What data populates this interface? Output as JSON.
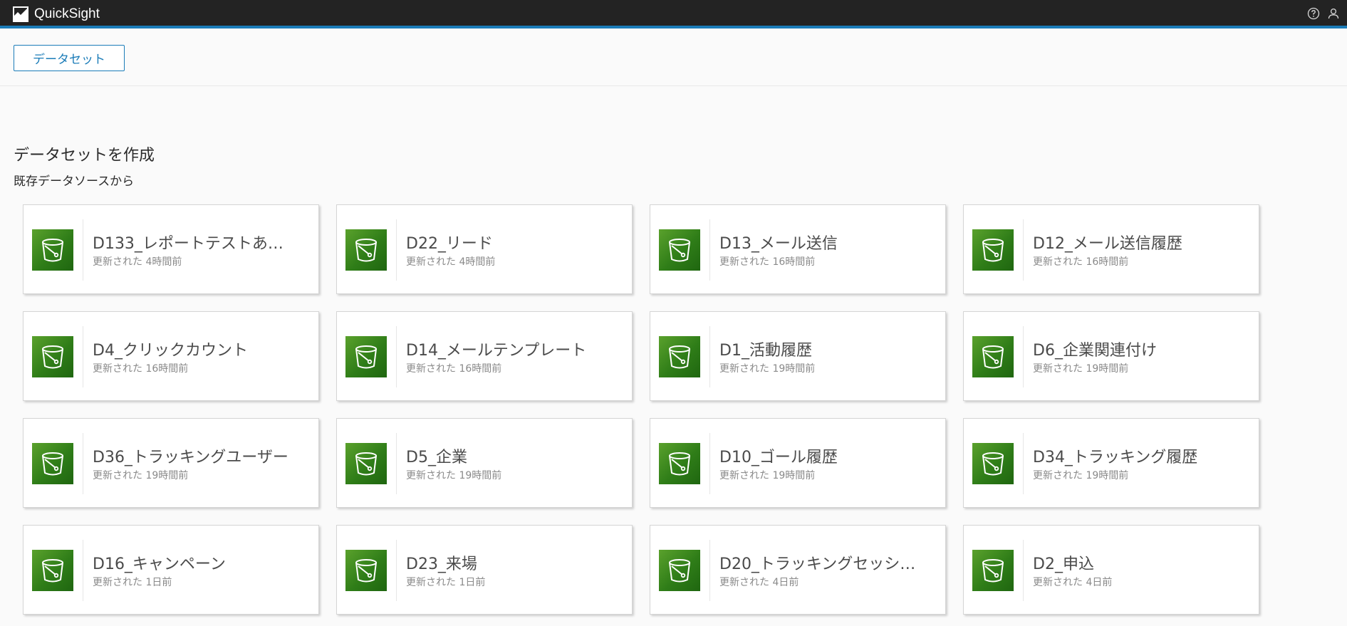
{
  "topbar": {
    "brand": "QuickSight",
    "icons": [
      "help-icon",
      "user-icon"
    ]
  },
  "toolbar": {
    "dataset_label": "データセット"
  },
  "section": {
    "title": "データセットを作成",
    "subtitle": "既存データソースから"
  },
  "colors": {
    "accent": "#1b7cb8",
    "topbar_bg": "#232323",
    "icon_green": "#3a8a1e"
  },
  "cards": [
    {
      "name": "D133_レポートテストあ…",
      "updated": "更新された 4時間前"
    },
    {
      "name": "D22_リード",
      "updated": "更新された 4時間前"
    },
    {
      "name": "D13_メール送信",
      "updated": "更新された 16時間前"
    },
    {
      "name": "D12_メール送信履歴",
      "updated": "更新された 16時間前"
    },
    {
      "name": "D4_クリックカウント",
      "updated": "更新された 16時間前"
    },
    {
      "name": "D14_メールテンプレート",
      "updated": "更新された 16時間前"
    },
    {
      "name": "D1_活動履歴",
      "updated": "更新された 19時間前"
    },
    {
      "name": "D6_企業関連付け",
      "updated": "更新された 19時間前"
    },
    {
      "name": "D36_トラッキングユーザー",
      "updated": "更新された 19時間前"
    },
    {
      "name": "D5_企業",
      "updated": "更新された 19時間前"
    },
    {
      "name": "D10_ゴール履歴",
      "updated": "更新された 19時間前"
    },
    {
      "name": "D34_トラッキング履歴",
      "updated": "更新された 19時間前"
    },
    {
      "name": "D16_キャンペーン",
      "updated": "更新された 1日前"
    },
    {
      "name": "D23_来場",
      "updated": "更新された 1日前"
    },
    {
      "name": "D20_トラッキングセッシ…",
      "updated": "更新された 4日前"
    },
    {
      "name": "D2_申込",
      "updated": "更新された 4日前"
    }
  ]
}
